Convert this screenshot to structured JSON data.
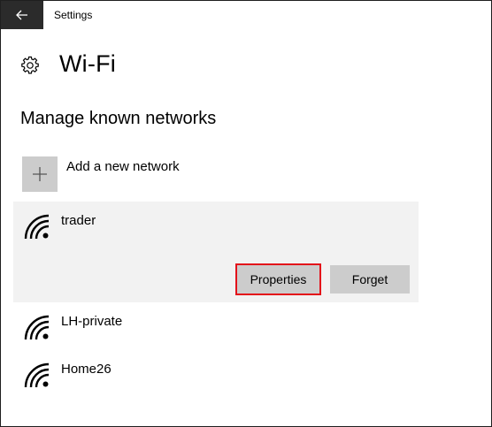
{
  "window": {
    "title": "Settings"
  },
  "page": {
    "title": "Wi-Fi",
    "icon": "gear-icon"
  },
  "section": {
    "title": "Manage known networks"
  },
  "add_network": {
    "label": "Add a new network",
    "icon": "plus-icon"
  },
  "networks": [
    {
      "name": "trader",
      "icon": "wifi-icon",
      "selected": true
    },
    {
      "name": "LH-private",
      "icon": "wifi-icon",
      "selected": false
    },
    {
      "name": "Home26",
      "icon": "wifi-icon",
      "selected": false
    }
  ],
  "actions": {
    "properties_label": "Properties",
    "forget_label": "Forget"
  },
  "colors": {
    "titlebar_back": "#2b2b2b",
    "selected_bg": "#f2f2f2",
    "button_bg": "#cccccc",
    "highlight": "#e3101a"
  }
}
